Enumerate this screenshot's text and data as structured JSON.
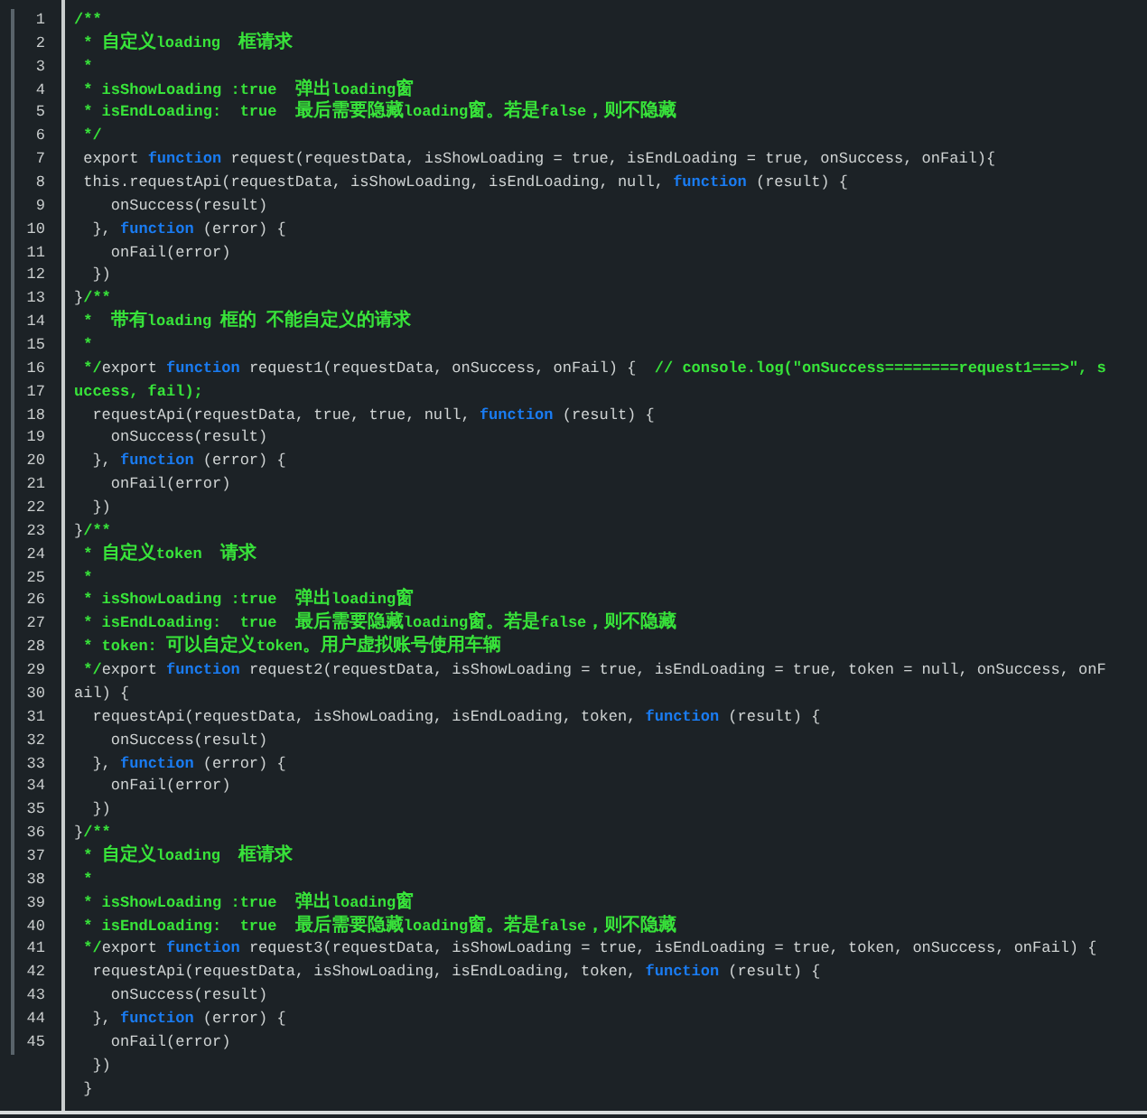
{
  "editor": {
    "lines": [
      {
        "number": "1",
        "tokens": [
          {
            "kind": "comment",
            "text": "/**"
          }
        ]
      },
      {
        "number": "2",
        "tokens": [
          {
            "kind": "comment",
            "text": " * 自定义loading  框请求"
          }
        ]
      },
      {
        "number": "3",
        "tokens": [
          {
            "kind": "comment",
            "text": " *"
          }
        ]
      },
      {
        "number": "4",
        "tokens": [
          {
            "kind": "comment",
            "text": " * isShowLoading :true  弹出loading窗"
          }
        ]
      },
      {
        "number": "5",
        "tokens": [
          {
            "kind": "comment",
            "text": " * isEndLoading:  true  最后需要隐藏loading窗。若是false，则不隐藏"
          }
        ]
      },
      {
        "number": "6",
        "tokens": [
          {
            "kind": "comment",
            "text": " */"
          }
        ]
      },
      {
        "number": "7",
        "tokens": [
          {
            "kind": "plain",
            "text": " export "
          },
          {
            "kind": "keyword",
            "text": "function"
          },
          {
            "kind": "plain",
            "text": " request(requestData, isShowLoading = true, isEndLoading = true, onSuccess, onFail){"
          }
        ]
      },
      {
        "number": "8",
        "tokens": [
          {
            "kind": "plain",
            "text": " this.requestApi(requestData, isShowLoading, isEndLoading, null, "
          },
          {
            "kind": "keyword",
            "text": "function"
          },
          {
            "kind": "plain",
            "text": " (result) {"
          }
        ]
      },
      {
        "number": "9",
        "tokens": [
          {
            "kind": "plain",
            "text": "    onSuccess(result)"
          }
        ]
      },
      {
        "number": "10",
        "tokens": [
          {
            "kind": "plain",
            "text": "  }, "
          },
          {
            "kind": "keyword",
            "text": "function"
          },
          {
            "kind": "plain",
            "text": " (error) {"
          }
        ]
      },
      {
        "number": "11",
        "tokens": [
          {
            "kind": "plain",
            "text": "    onFail(error)"
          }
        ]
      },
      {
        "number": "12",
        "tokens": [
          {
            "kind": "plain",
            "text": "  })"
          }
        ]
      },
      {
        "number": "13",
        "tokens": [
          {
            "kind": "plain",
            "text": "}"
          },
          {
            "kind": "comment",
            "text": "/**"
          }
        ]
      },
      {
        "number": "14",
        "tokens": [
          {
            "kind": "comment",
            "text": " *  带有loading 框的 不能自定义的请求"
          }
        ]
      },
      {
        "number": "15",
        "tokens": [
          {
            "kind": "comment",
            "text": " *"
          }
        ]
      },
      {
        "number": "16",
        "tokens": [
          {
            "kind": "comment",
            "text": " */"
          },
          {
            "kind": "plain",
            "text": "export "
          },
          {
            "kind": "keyword",
            "text": "function"
          },
          {
            "kind": "plain",
            "text": " request1(requestData, onSuccess, onFail) {  "
          },
          {
            "kind": "comment",
            "text": "// console.log(\"onSuccess========request1===>\", s"
          }
        ]
      },
      {
        "number": "17",
        "tokens": [
          {
            "kind": "comment",
            "text": "uccess, fail);"
          }
        ]
      },
      {
        "number": "18",
        "tokens": [
          {
            "kind": "plain",
            "text": "  requestApi(requestData, true, true, null, "
          },
          {
            "kind": "keyword",
            "text": "function"
          },
          {
            "kind": "plain",
            "text": " (result) {"
          }
        ]
      },
      {
        "number": "19",
        "tokens": [
          {
            "kind": "plain",
            "text": "    onSuccess(result)"
          }
        ]
      },
      {
        "number": "20",
        "tokens": [
          {
            "kind": "plain",
            "text": "  }, "
          },
          {
            "kind": "keyword",
            "text": "function"
          },
          {
            "kind": "plain",
            "text": " (error) {"
          }
        ]
      },
      {
        "number": "21",
        "tokens": [
          {
            "kind": "plain",
            "text": "    onFail(error)"
          }
        ]
      },
      {
        "number": "22",
        "tokens": [
          {
            "kind": "plain",
            "text": "  })"
          }
        ]
      },
      {
        "number": "23",
        "tokens": [
          {
            "kind": "plain",
            "text": "}"
          },
          {
            "kind": "comment",
            "text": "/**"
          }
        ]
      },
      {
        "number": "24",
        "tokens": [
          {
            "kind": "comment",
            "text": " * 自定义token  请求"
          }
        ]
      },
      {
        "number": "25",
        "tokens": [
          {
            "kind": "comment",
            "text": " *"
          }
        ]
      },
      {
        "number": "26",
        "tokens": [
          {
            "kind": "comment",
            "text": " * isShowLoading :true  弹出loading窗"
          }
        ]
      },
      {
        "number": "27",
        "tokens": [
          {
            "kind": "comment",
            "text": " * isEndLoading:  true  最后需要隐藏loading窗。若是false，则不隐藏"
          }
        ]
      },
      {
        "number": "28",
        "tokens": [
          {
            "kind": "comment",
            "text": " * token: 可以自定义token。用户虚拟账号使用车辆"
          }
        ]
      },
      {
        "number": "29",
        "tokens": [
          {
            "kind": "comment",
            "text": " */"
          },
          {
            "kind": "plain",
            "text": "export "
          },
          {
            "kind": "keyword",
            "text": "function"
          },
          {
            "kind": "plain",
            "text": " request2(requestData, isShowLoading = true, isEndLoading = true, token = null, onSuccess, onF"
          }
        ]
      },
      {
        "number": "30",
        "tokens": [
          {
            "kind": "plain",
            "text": "ail) {"
          }
        ]
      },
      {
        "number": "31",
        "tokens": [
          {
            "kind": "plain",
            "text": "  requestApi(requestData, isShowLoading, isEndLoading, token, "
          },
          {
            "kind": "keyword",
            "text": "function"
          },
          {
            "kind": "plain",
            "text": " (result) {"
          }
        ]
      },
      {
        "number": "32",
        "tokens": [
          {
            "kind": "plain",
            "text": "    onSuccess(result)"
          }
        ]
      },
      {
        "number": "33",
        "tokens": [
          {
            "kind": "plain",
            "text": "  }, "
          },
          {
            "kind": "keyword",
            "text": "function"
          },
          {
            "kind": "plain",
            "text": " (error) {"
          }
        ]
      },
      {
        "number": "34",
        "tokens": [
          {
            "kind": "plain",
            "text": "    onFail(error)"
          }
        ]
      },
      {
        "number": "35",
        "tokens": [
          {
            "kind": "plain",
            "text": "  })"
          }
        ]
      },
      {
        "number": "36",
        "tokens": [
          {
            "kind": "plain",
            "text": "}"
          },
          {
            "kind": "comment",
            "text": "/**"
          }
        ]
      },
      {
        "number": "37",
        "tokens": [
          {
            "kind": "comment",
            "text": " * 自定义loading  框请求"
          }
        ]
      },
      {
        "number": "38",
        "tokens": [
          {
            "kind": "comment",
            "text": " *"
          }
        ]
      },
      {
        "number": "39",
        "tokens": [
          {
            "kind": "comment",
            "text": " * isShowLoading :true  弹出loading窗"
          }
        ]
      },
      {
        "number": "40",
        "tokens": [
          {
            "kind": "comment",
            "text": " * isEndLoading:  true  最后需要隐藏loading窗。若是false，则不隐藏"
          }
        ]
      },
      {
        "number": "41",
        "tokens": [
          {
            "kind": "comment",
            "text": " */"
          },
          {
            "kind": "plain",
            "text": "export "
          },
          {
            "kind": "keyword",
            "text": "function"
          },
          {
            "kind": "plain",
            "text": " request3(requestData, isShowLoading = true, isEndLoading = true, token, onSuccess, onFail) {"
          }
        ]
      },
      {
        "number": "42",
        "tokens": [
          {
            "kind": "plain",
            "text": "  requestApi(requestData, isShowLoading, isEndLoading, token, "
          },
          {
            "kind": "keyword",
            "text": "function"
          },
          {
            "kind": "plain",
            "text": " (result) {"
          }
        ]
      },
      {
        "number": "43",
        "tokens": [
          {
            "kind": "plain",
            "text": "    onSuccess(result)"
          }
        ]
      },
      {
        "number": "44",
        "tokens": [
          {
            "kind": "plain",
            "text": "  }, "
          },
          {
            "kind": "keyword",
            "text": "function"
          },
          {
            "kind": "plain",
            "text": " (error) {"
          }
        ]
      },
      {
        "number": "45",
        "tokens": [
          {
            "kind": "plain",
            "text": "    onFail(error)"
          }
        ]
      },
      {
        "tokens": [
          {
            "kind": "plain",
            "text": "  })"
          }
        ]
      },
      {
        "tokens": [
          {
            "kind": "plain",
            "text": " }"
          }
        ]
      }
    ]
  }
}
